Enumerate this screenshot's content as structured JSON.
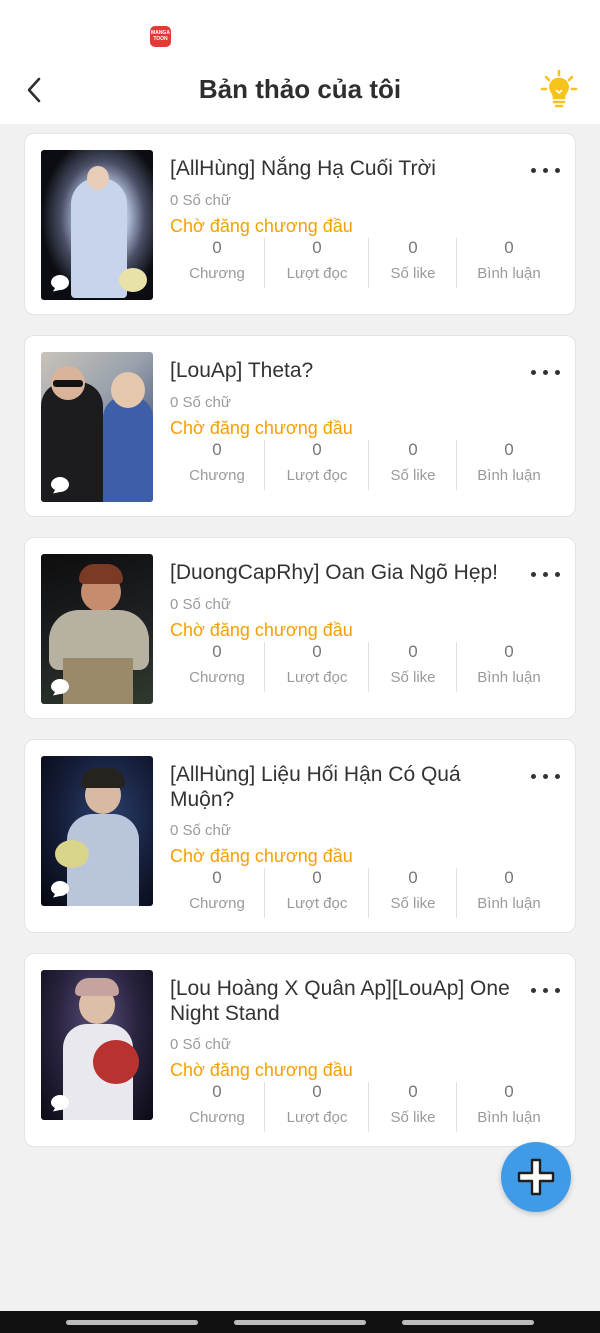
{
  "status_bar": {
    "app_badge_text": "MANGA TOON"
  },
  "header": {
    "title": "Bản thảo của tôi"
  },
  "stat_labels": [
    "Chương",
    "Lượt đọc",
    "Số like",
    "Bình luận"
  ],
  "drafts": [
    {
      "title": "[AllHùng] Nắng Hạ Cuối Trời",
      "word_count": "0 Số chữ",
      "status": "Chờ đăng chương đầu",
      "stats": [
        "0",
        "0",
        "0",
        "0"
      ]
    },
    {
      "title": "[LouAp] Theta?",
      "word_count": "0 Số chữ",
      "status": "Chờ đăng chương đầu",
      "stats": [
        "0",
        "0",
        "0",
        "0"
      ]
    },
    {
      "title": "[DuongCapRhy] Oan Gia Ngõ Hẹp!",
      "word_count": "0 Số chữ",
      "status": "Chờ đăng chương đầu",
      "stats": [
        "0",
        "0",
        "0",
        "0"
      ]
    },
    {
      "title": "[AllHùng] Liệu Hối Hận Có Quá Muộn?",
      "word_count": "0 Số chữ",
      "status": "Chờ đăng chương đầu",
      "stats": [
        "0",
        "0",
        "0",
        "0"
      ]
    },
    {
      "title": "[Lou Hoàng X Quân Ap][LouAp] One Night Stand",
      "word_count": "0 Số chữ",
      "status": "Chờ đăng chương đầu",
      "stats": [
        "0",
        "0",
        "0",
        "0"
      ]
    }
  ],
  "icons": {
    "back": "chevron-left-icon",
    "tips": "lightbulb-icon",
    "more": "more-dots-icon",
    "comment": "comment-bubble-icon",
    "add": "plus-icon"
  },
  "colors": {
    "status_orange": "#f5a000",
    "fab_blue": "#3f9be8",
    "bulb_yellow": "#f6c21c",
    "background": "#f1f1f1"
  }
}
